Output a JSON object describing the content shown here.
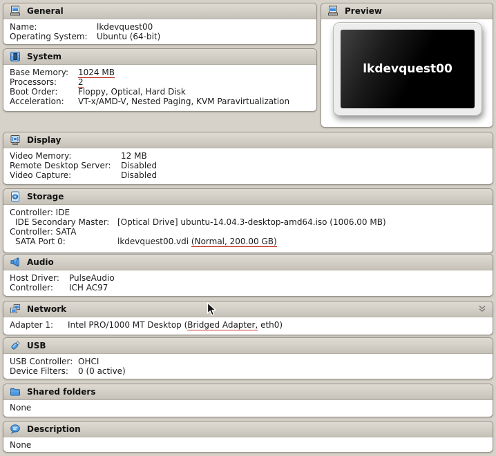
{
  "page": {
    "background": "#d6d2c9",
    "accent_blue": "#3f8fe0",
    "underline_red": "#c0392b"
  },
  "preview": {
    "title": "Preview",
    "icon": "machine-monitor-icon",
    "screen_label": "lkdevquest00"
  },
  "sections": [
    {
      "id": "general",
      "title": "General",
      "icon": "machine-monitor-icon",
      "rows": [
        {
          "label": "Name:",
          "parts": [
            {
              "t": "lkdevquest00"
            }
          ]
        },
        {
          "label": "Operating System:",
          "parts": [
            {
              "t": "Ubuntu (64-bit)"
            }
          ]
        }
      ]
    },
    {
      "id": "system",
      "title": "System",
      "icon": "cpu-chip-icon",
      "rows": [
        {
          "label": "Base Memory:",
          "parts": [
            {
              "t": "1024 MB",
              "u": true
            }
          ]
        },
        {
          "label": "Processors:",
          "parts": [
            {
              "t": "2",
              "u": true
            }
          ]
        },
        {
          "label": "Boot Order:",
          "parts": [
            {
              "t": "Floppy, Optical, Hard Disk"
            }
          ]
        },
        {
          "label": "Acceleration:",
          "parts": [
            {
              "t": "VT-x/AMD-V, Nested Paging, KVM Paravirtualization"
            }
          ]
        }
      ]
    },
    {
      "id": "display",
      "title": "Display",
      "icon": "display-monitor-icon",
      "rows": [
        {
          "label": "Video Memory:",
          "parts": [
            {
              "t": "12 MB"
            }
          ]
        },
        {
          "label": "Remote Desktop Server:",
          "parts": [
            {
              "t": "Disabled"
            }
          ]
        },
        {
          "label": "Video Capture:",
          "parts": [
            {
              "t": "Disabled"
            }
          ]
        }
      ]
    },
    {
      "id": "storage",
      "title": "Storage",
      "icon": "hard-disk-icon",
      "rows": [
        {
          "text": "Controller: IDE"
        },
        {
          "label": "IDE Secondary Master:",
          "indent": true,
          "parts": [
            {
              "t": "[Optical Drive] ubuntu-14.04.3-desktop-amd64.iso (1006.00 MB)"
            }
          ]
        },
        {
          "text": "Controller: SATA"
        },
        {
          "label": "SATA Port 0:",
          "indent": true,
          "parts": [
            {
              "t": "lkdevquest00.vdi "
            },
            {
              "t": "(Normal, 200.00 GB)",
              "u": true
            }
          ]
        }
      ]
    },
    {
      "id": "audio",
      "title": "Audio",
      "icon": "speaker-icon",
      "rows": [
        {
          "label": "Host Driver:",
          "parts": [
            {
              "t": "PulseAudio"
            }
          ]
        },
        {
          "label": "Controller:",
          "parts": [
            {
              "t": "ICH AC97"
            }
          ]
        }
      ]
    },
    {
      "id": "network",
      "title": "Network",
      "icon": "network-adapters-icon",
      "expander_icon": "chevron-double-down-icon",
      "rows": [
        {
          "label": "Adapter 1:",
          "parts": [
            {
              "t": "Intel PRO/1000 MT Desktop ("
            },
            {
              "t": "Bridged Adapter,",
              "u": true
            },
            {
              "t": " eth0)"
            }
          ]
        }
      ]
    },
    {
      "id": "usb",
      "title": "USB",
      "icon": "usb-plug-icon",
      "rows": [
        {
          "label": "USB Controller:",
          "parts": [
            {
              "t": "OHCI"
            }
          ]
        },
        {
          "label": "Device Filters:",
          "parts": [
            {
              "t": "0 (0 active)"
            }
          ]
        }
      ]
    },
    {
      "id": "shared_folders",
      "title": "Shared folders",
      "icon": "folder-icon",
      "rows": [
        {
          "parts": [
            {
              "t": "None"
            }
          ]
        }
      ]
    },
    {
      "id": "description",
      "title": "Description",
      "icon": "comment-bubble-icon",
      "rows": [
        {
          "parts": [
            {
              "t": "None"
            }
          ]
        }
      ]
    }
  ]
}
